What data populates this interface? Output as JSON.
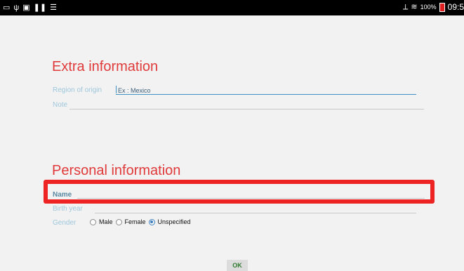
{
  "status_bar": {
    "battery": "100%",
    "time": "09:5",
    "icons_left": [
      "cast-icon",
      "usb-icon",
      "screenshot-icon",
      "pause-icon",
      "wifi-icon"
    ],
    "icons_right": [
      "no-signal-icon",
      "wifi-icon",
      "battery-icon"
    ]
  },
  "extra_section": {
    "title": "Extra information",
    "region_label": "Region of origin",
    "region_placeholder": "Ex : Mexico",
    "note_label": "Note"
  },
  "personal_section": {
    "title": "Personal information",
    "name_label": "Name",
    "birth_year_label": "Birth year",
    "gender_label": "Gender",
    "gender_options": [
      "Male",
      "Female",
      "Unspecified"
    ],
    "gender_selected": "Unspecified"
  },
  "actions": {
    "ok_label": "OK"
  },
  "colors": {
    "title_red": "#e03a3a",
    "label_blue": "#9ec7dc",
    "accent_blue": "#3f93c4",
    "highlight_red": "#ee2323"
  }
}
